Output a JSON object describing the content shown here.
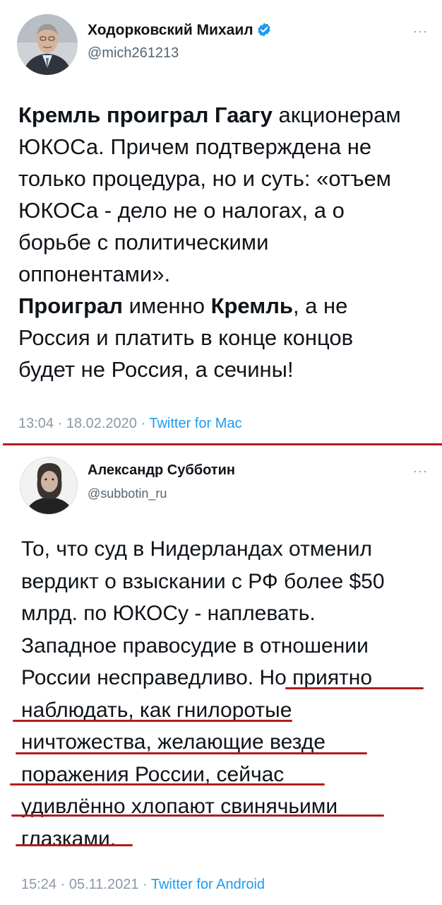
{
  "tweet1": {
    "author_name": "Ходорковский Михаил",
    "handle": "@mich261213",
    "more_label": "···",
    "lines": [
      {
        "bold": "Кремль проиграл Гаагу",
        "rest": " акционерам"
      },
      {
        "bold": "",
        "rest": "ЮКОСа. Причем подтверждена не"
      },
      {
        "bold": "",
        "rest": "только процедура, но и суть: «отъем"
      },
      {
        "bold": "",
        "rest": "ЮКОСа - дело не о налогах, а о"
      },
      {
        "bold": "",
        "rest": "борьбе с политическими"
      },
      {
        "bold": "",
        "rest": "оппонентами»."
      }
    ],
    "line7_a": "Проиграл",
    "line7_b": " именно ",
    "line7_c": "Кремль",
    "line7_d": ", а не",
    "line8": "Россия и платить в конце концов",
    "line9": "будет не Россия, а сечины!",
    "time": "13:04 · 18.02.2020 · ",
    "source": "Twitter for Mac"
  },
  "tweet2": {
    "author_name": "Александр Субботин",
    "handle": "@subbotin_ru",
    "more_label": "···",
    "lines": [
      "То, что суд в Нидерландах отменил",
      "вердикт о взыскании с РФ более $50",
      "млрд. по ЮКОСу - наплевать.",
      "Западное правосудие в отношении",
      "России несправедливо. Но приятно",
      "наблюдать, как гнилоротые",
      "ничтожества, желающие везде",
      "поражения России, сейчас",
      "удивлённо хлопают свинячьими",
      "глазками."
    ],
    "time": "15:24 · 05.11.2021 · ",
    "source": "Twitter for Android"
  },
  "colors": {
    "accent": "#1d9bf0",
    "annotation_red": "#b01c1c",
    "secondary_text": "#536471"
  },
  "icons": {
    "verified": "verified-badge-icon",
    "more": "more-options-icon"
  }
}
